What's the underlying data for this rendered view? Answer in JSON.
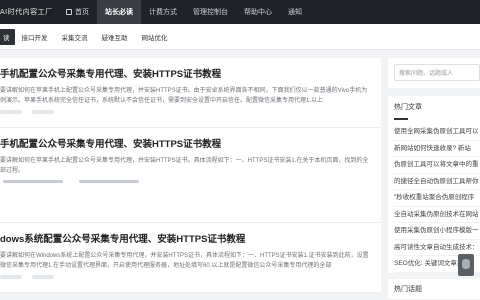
{
  "brand": "AI时代内容工厂",
  "nav": {
    "items": [
      {
        "label": "首页",
        "active": false
      },
      {
        "label": "站长必读",
        "active": true
      },
      {
        "label": "计费方式",
        "active": false
      },
      {
        "label": "管理控制台",
        "active": false
      },
      {
        "label": "帮助中心",
        "active": false
      },
      {
        "label": "通知",
        "active": false
      }
    ]
  },
  "subnav": {
    "items": [
      {
        "label": "读",
        "active": true
      },
      {
        "label": "接口开发",
        "active": false
      },
      {
        "label": "采集交流",
        "active": false
      },
      {
        "label": "疑难互助",
        "active": false
      },
      {
        "label": "网站优化",
        "active": false
      }
    ]
  },
  "articles": [
    {
      "title": "手机配置公众号采集专用代理、安装HTTPS证书教程",
      "desc": "要讲解如何在苹果手机上配置公众号采集专用代理，并安装HTTPS证书。由于安卓系统界面各不相同，下面我们仅以一款普通的Vivo手机为例演示。苹果手机系统完全信任证书，系统默认不会信任证书，需要到安全设置中开启信任。配置微信采集专用代理1.以上"
    },
    {
      "title": "手机配置公众号采集专用代理、安装HTTPS证书教程",
      "desc": "要讲解如何在苹果手机上配置公众号采集专用代理，并安装HTTPS证书。具体流程如下：一、HTTPS证书安装1.在关于本机页面，找到的全部过程。"
    },
    {
      "title": "dows系统配置公众号采集专用代理、安装HTTPS证书教程",
      "desc": "要讲解如何在Windows系统上配置公众号采集专用代理，并安装HTTPS证书，具体流程如下：一、HTTPS证书安装1.证书安装到此前，设置微信采集专用代理1.在手动设置代理界面，开启使用代理服务器，地址处填写60.以上就是配置微信公众号采集专用代理的全部"
    }
  ],
  "sidebar": {
    "search_placeholder": "搜索问题、话题或人",
    "hot_title": "热门文章",
    "hot_items": [
      "使用全网采集伪原创工具可以",
      "新网站如何快速收录? 新站",
      "伪原创工具可以将文章中的重",
      "的捷径全自动伪原创工具帮你",
      "  \"秒收权重站聚合伪原创程序",
      "全自动采集伪原创技术在网站",
      "使用采集伪原创小程序模版一",
      "高可读性文章自动生成技术：",
      "SEO优化: 关键词文章采集"
    ],
    "tags_title": "热门话题"
  }
}
